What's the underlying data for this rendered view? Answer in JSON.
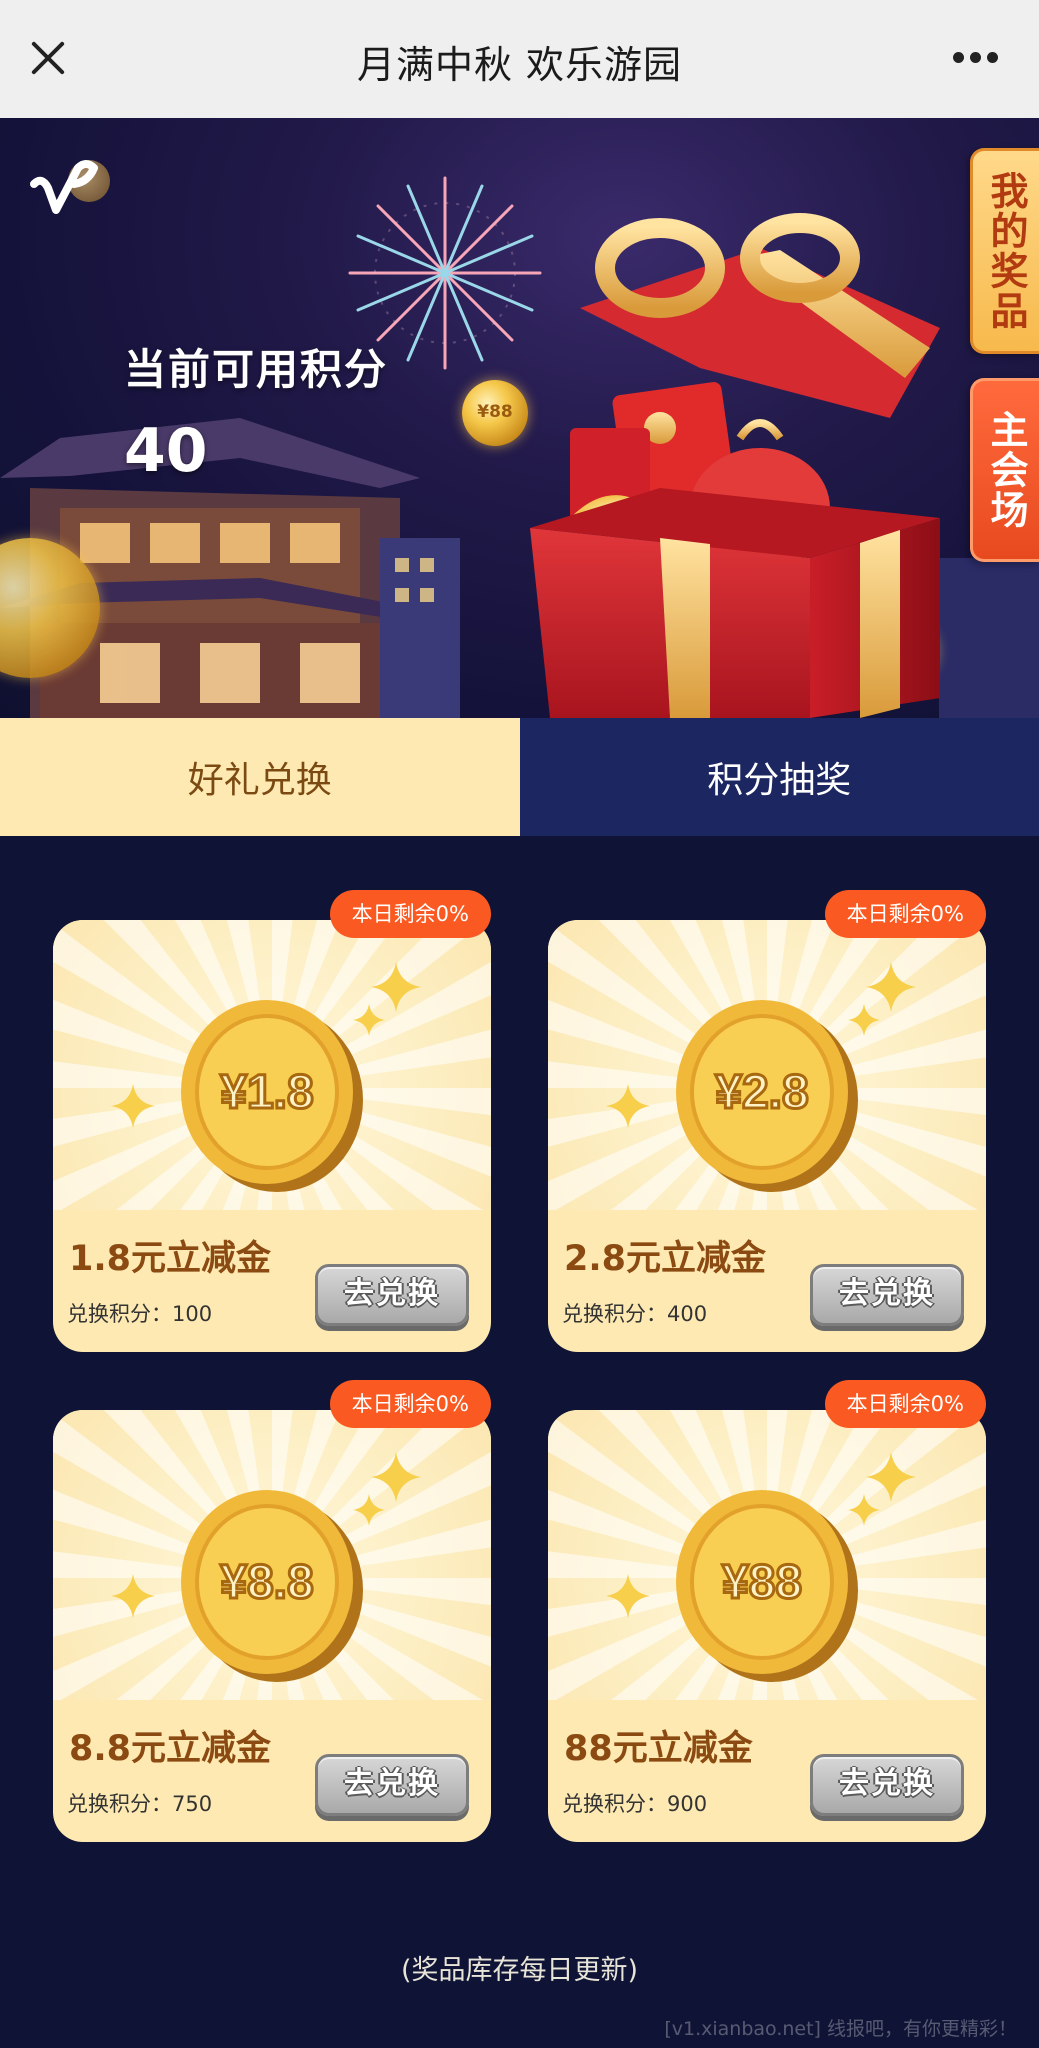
{
  "topbar": {
    "title": "月满中秋 欢乐游园"
  },
  "hero": {
    "points_label": "当前可用积分",
    "points_value": "40",
    "side_buttons": {
      "my_prizes": "我的奖品",
      "main_venue": "主会场"
    },
    "floating_coin_label": "¥88"
  },
  "tabs": {
    "exchange": "好礼兑换",
    "lottery": "积分抽奖",
    "active": "exchange"
  },
  "cards": [
    {
      "badge": "本日剩余0%",
      "coin_label": "¥1.8",
      "title": "1.8元立减金",
      "cost_label": "兑换积分：",
      "cost_value": "100",
      "button": "去兑换"
    },
    {
      "badge": "本日剩余0%",
      "coin_label": "¥2.8",
      "title": "2.8元立减金",
      "cost_label": "兑换积分：",
      "cost_value": "400",
      "button": "去兑换"
    },
    {
      "badge": "本日剩余0%",
      "coin_label": "¥8.8",
      "title": "8.8元立减金",
      "cost_label": "兑换积分：",
      "cost_value": "750",
      "button": "去兑换"
    },
    {
      "badge": "本日剩余0%",
      "coin_label": "¥88",
      "title": "88元立减金",
      "cost_label": "兑换积分：",
      "cost_value": "900",
      "button": "去兑换"
    }
  ],
  "footer": {
    "note": "(奖品库存每日更新)",
    "watermark": "[v1.xianbao.net] 线报吧，有你更精彩！"
  },
  "colors": {
    "page_background": "#0f1436",
    "tab_active_bg": "#fde9b1",
    "tab_inactive_bg": "#1c2660",
    "badge": "#fa5a22",
    "card_title": "#8a4a12",
    "side_btn_main": "#e84a1f"
  },
  "icons": {
    "close": "close-icon",
    "more": "more-icon",
    "logo": "logo-icon",
    "coin": "coin-icon",
    "sparkle": "sparkle-icon",
    "gift": "gift-box-icon"
  }
}
